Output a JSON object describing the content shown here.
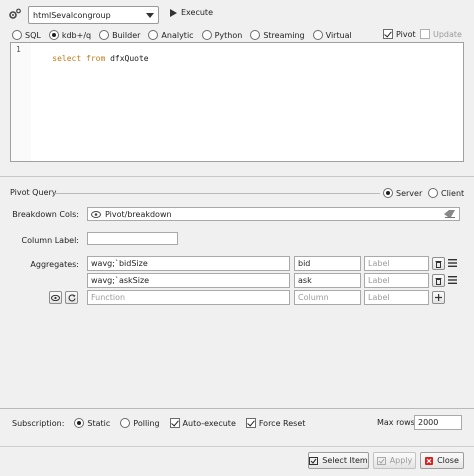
{
  "toolbar": {
    "server_combo": "htmlSevalcongroup",
    "execute_label": "Execute"
  },
  "query_modes": [
    {
      "label": "SQL",
      "selected": false
    },
    {
      "label": "kdb+/q",
      "selected": true
    },
    {
      "label": "Builder",
      "selected": false
    },
    {
      "label": "Analytic",
      "selected": false
    },
    {
      "label": "Python",
      "selected": false
    },
    {
      "label": "Streaming",
      "selected": false
    },
    {
      "label": "Virtual",
      "selected": false
    }
  ],
  "pivot_check": {
    "label": "Pivot",
    "checked": true
  },
  "update_check": {
    "label": "Update",
    "checked": false,
    "disabled": true
  },
  "editor": {
    "line_number": "1",
    "keyword_select": "select",
    "keyword_from": "from",
    "table_name": "dfxQuote"
  },
  "pivot": {
    "title": "Pivot Query",
    "server_label": "Server",
    "client_label": "Client",
    "breakdown_label": "Breakdown Cols:",
    "breakdown_value": "Pivot/breakdown",
    "column_label_label": "Column Label:",
    "column_label_value": "",
    "aggregates_label": "Aggregates:",
    "aggregates": [
      {
        "function": "wavg;`bidSize",
        "column": "bid",
        "label_placeholder": "Label"
      },
      {
        "function": "wavg;`askSize",
        "column": "ask",
        "label_placeholder": "Label"
      }
    ],
    "new_row": {
      "function_placeholder": "Function",
      "column_placeholder": "Column",
      "label_placeholder": "Label"
    }
  },
  "footer": {
    "subscription_label": "Subscription:",
    "static_label": "Static",
    "polling_label": "Polling",
    "auto_execute_label": "Auto-execute",
    "force_reset_label": "Force Reset",
    "max_rows_label": "Max rows:",
    "max_rows_value": "2000"
  },
  "buttons": {
    "select_item": "Select Item",
    "apply": "Apply",
    "close": "Close"
  },
  "colors": {
    "keyword": "#c07a1a",
    "table": "#1a1a1a",
    "close_icon": "#d62020"
  }
}
